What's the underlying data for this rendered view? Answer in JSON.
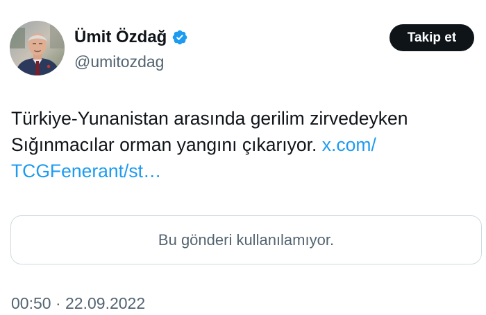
{
  "author": {
    "display_name": "Ümit Özdağ",
    "handle": "@umitozdag",
    "verified": true,
    "avatar_alt": "profile photo"
  },
  "follow_button": {
    "label": "Takip et"
  },
  "tweet": {
    "text_line1": "Türkiye-Yunanistan arasında gerilim zirvedeyken",
    "text_line2": "Sığınmacılar orman yangını çıkarıyor.",
    "link_part1": "x.com/",
    "link_part2": "TCGFenerant/st…"
  },
  "quoted_card": {
    "message": "Bu gönderi kullanılamıyor."
  },
  "meta": {
    "time": "00:50",
    "separator": "·",
    "date": "22.09.2022"
  },
  "colors": {
    "link": "#1d9bf0",
    "verified_badge": "#1d9bf0",
    "secondary_text": "#536471",
    "primary_text": "#0f1419",
    "button_bg": "#0f1419",
    "card_border": "#cfd9de"
  }
}
